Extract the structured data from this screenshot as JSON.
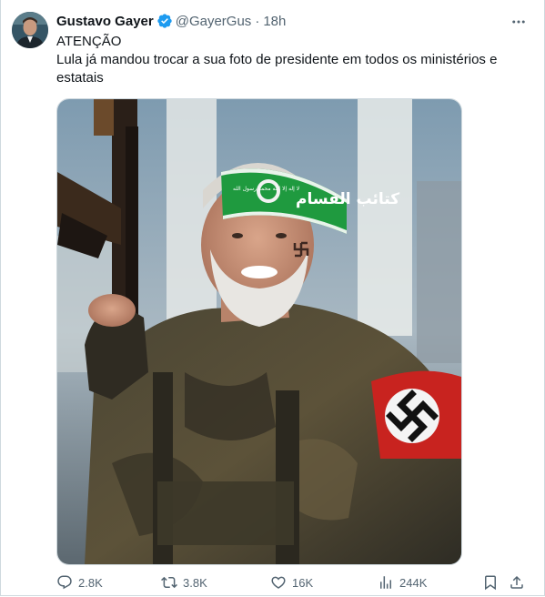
{
  "post": {
    "author": {
      "name": "Gustavo Gayer",
      "handle": "@GayerGus",
      "separator": "·",
      "time": "18h"
    },
    "text_lines": [
      "ATENÇÃO",
      "Lula já mandou trocar a sua foto de presidente em todos os ministérios e",
      "estatais"
    ],
    "media": {
      "headband_text": "كتائب القسام",
      "headband_small": "لا إله إلا الله   محمد رسول الله"
    },
    "metrics": {
      "replies": "2.8K",
      "reposts": "3.8K",
      "likes": "16K",
      "views": "244K"
    }
  },
  "colors": {
    "verified": "#1d9bf0",
    "muted_text": "#536471",
    "headband": "#1f9a3f",
    "armband": "#c8231f"
  }
}
